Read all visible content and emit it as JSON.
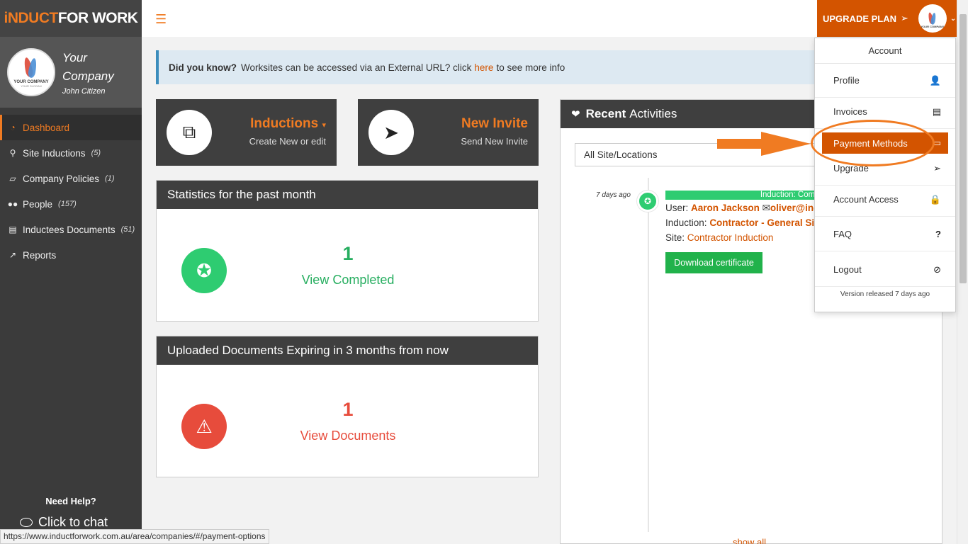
{
  "brand": {
    "part1": "iNDUCT",
    "part2": "FOR WORK"
  },
  "profile": {
    "company": "Your Company",
    "user": "John Citizen",
    "logo_text": "YOUR COMPANY",
    "logo_sub": "YOUR SLOGAN"
  },
  "sidebar": {
    "items": [
      {
        "label": "Dashboard",
        "count": "",
        "icon": "dashboard-icon"
      },
      {
        "label": "Site Inductions",
        "count": "(5)",
        "icon": "map-marker-icon"
      },
      {
        "label": "Company Policies",
        "count": "(1)",
        "icon": "book-icon"
      },
      {
        "label": "People",
        "count": "(157)",
        "icon": "users-icon"
      },
      {
        "label": "Inductees Documents",
        "count": "(51)",
        "icon": "file-icon"
      },
      {
        "label": "Reports",
        "count": "",
        "icon": "chart-icon"
      }
    ],
    "need_help": "Need Help?",
    "chat": "Click to chat"
  },
  "topbar": {
    "upgrade_label": "UPGRADE PLAN"
  },
  "alert": {
    "strong": "Did you know?",
    "text": "Worksites can be accessed via an External URL? click",
    "link": "here",
    "tail": "to see more info"
  },
  "tiles": [
    {
      "title": "Inductions",
      "sub": "Create New or edit"
    },
    {
      "title": "New Invite",
      "sub": "Send New Invite"
    }
  ],
  "stats": {
    "title": "Statistics for the past month",
    "count": "1",
    "link": "View Completed"
  },
  "docs": {
    "title": "Uploaded Documents Expiring in 3 months from now",
    "count": "1",
    "link": "View Documents"
  },
  "recent": {
    "title_bold": "Recent",
    "title_rest": "Activities",
    "filter": "All Site/Locations",
    "time_ago": "7 days ago",
    "status": "Induction: Complete",
    "user_label": "User:",
    "user_name": "Aaron Jackson",
    "user_email": "oliver@ind",
    "induction_label": "Induction:",
    "induction_value": "Contractor - General Sit",
    "site_label": "Site:",
    "site_value": "Contractor Induction",
    "download": "Download certificate",
    "show_all": "show all"
  },
  "dropdown": {
    "header": "Account",
    "items": [
      {
        "label": "Profile",
        "icon": "user-icon"
      },
      {
        "label": "Invoices",
        "icon": "document-icon"
      },
      {
        "label": "Payment Methods",
        "icon": "credit-card-icon"
      },
      {
        "label": "Upgrade",
        "icon": "paper-plane-icon"
      },
      {
        "label": "Account Access",
        "icon": "lock-icon"
      },
      {
        "label": "FAQ",
        "icon": "question-icon"
      },
      {
        "label": "Logout",
        "icon": "ban-icon"
      }
    ],
    "footer": "Version released 7 days ago"
  },
  "status_url": "https://www.inductforwork.com.au/area/companies/#/payment-options",
  "colors": {
    "accent": "#d35400",
    "sidebar": "#3b3b3b",
    "success": "#2ecc71",
    "danger": "#e74c3c"
  }
}
